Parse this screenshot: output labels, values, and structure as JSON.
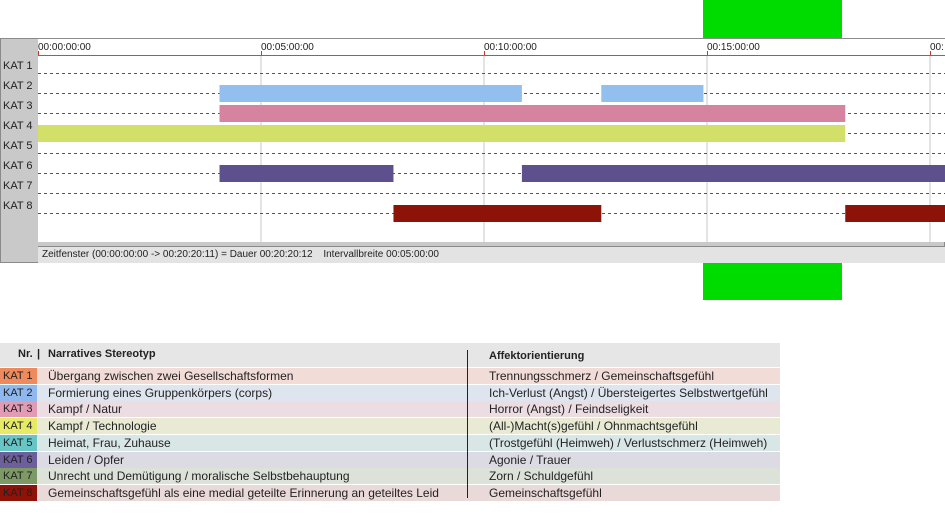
{
  "timeline": {
    "tick_labels": [
      "00:00:00:00",
      "00:05:00:00",
      "00:10:00:00",
      "00:15:00:00",
      "00:"
    ],
    "row_labels": [
      "KAT 1",
      "KAT 2",
      "KAT 3",
      "KAT 4",
      "KAT 5",
      "KAT 6",
      "KAT 7",
      "KAT 8"
    ],
    "status": {
      "window": "Zeitfenster (00:00:00:00 -> 00:20:20:11) = Dauer 00:20:20:12",
      "interval": "Intervallbreite 00:05:00:00"
    },
    "marker_color": "#00dc00"
  },
  "chart_data": {
    "type": "bar",
    "orientation": "timeline",
    "x_unit": "minutes",
    "xlim": [
      0,
      20.35
    ],
    "x_ticks": [
      0,
      5,
      10,
      15,
      20
    ],
    "highlight_range": [
      15,
      18.1
    ],
    "categories": [
      "KAT 1",
      "KAT 2",
      "KAT 3",
      "KAT 4",
      "KAT 5",
      "KAT 6",
      "KAT 7",
      "KAT 8"
    ],
    "series": [
      {
        "category": "KAT 1",
        "color": "#e8845a",
        "segments": []
      },
      {
        "category": "KAT 2",
        "color": "#92bff0",
        "segments": [
          [
            4.07,
            10.85
          ],
          [
            12.63,
            14.92
          ]
        ]
      },
      {
        "category": "KAT 3",
        "color": "#d5839f",
        "segments": [
          [
            4.07,
            18.1
          ]
        ]
      },
      {
        "category": "KAT 4",
        "color": "#d2e06a",
        "segments": [
          [
            0,
            18.1
          ]
        ]
      },
      {
        "category": "KAT 5",
        "color": "#5ec0c2",
        "segments": []
      },
      {
        "category": "KAT 6",
        "color": "#5e508c",
        "segments": [
          [
            4.07,
            7.97
          ],
          [
            10.85,
            20.35
          ]
        ]
      },
      {
        "category": "KAT 7",
        "color": "#6d8c5a",
        "segments": []
      },
      {
        "category": "KAT 8",
        "color": "#8d1208",
        "segments": [
          [
            7.97,
            12.63
          ],
          [
            18.1,
            20.35
          ]
        ]
      }
    ]
  },
  "legend": {
    "header": {
      "nr": "Nr.",
      "stereotype": "Narratives Stereotyp",
      "affekt": "Affektorientierung"
    },
    "rows": [
      {
        "kat": "KAT 1",
        "kat_color": "#ef8a5c",
        "bg": "#f1dcd8",
        "stereotype": "Übergang zwischen zwei Gesellschaftsformen",
        "affekt": "Trennungsschmerz / Gemeinschaftsgefühl"
      },
      {
        "kat": "KAT 2",
        "kat_color": "#8fb8ee",
        "bg": "#dfe5ee",
        "stereotype": "Formierung eines Gruppenkörpers (corps)",
        "affekt": "Ich-Verlust (Angst) / Übersteigertes Selbstwertgefühl"
      },
      {
        "kat": "KAT 3",
        "kat_color": "#e19bb5",
        "bg": "#ecdde3",
        "stereotype": "Kampf / Natur",
        "affekt": "Horror (Angst) / Feindseligkeit"
      },
      {
        "kat": "KAT 4",
        "kat_color": "#e6ea64",
        "bg": "#e8ead4",
        "stereotype": "Kampf / Technologie",
        "affekt": "(All-)Macht(s)gefühl / Ohnmachtsgefühl"
      },
      {
        "kat": "KAT 5",
        "kat_color": "#67c5c5",
        "bg": "#d8e6e6",
        "stereotype": "Heimat, Frau, Zuhause",
        "affekt": "(Trostgefühl (Heimweh) / Verlustschmerz (Heimweh)"
      },
      {
        "kat": "KAT 6",
        "kat_color": "#6d5e9c",
        "bg": "#dcdae3",
        "stereotype": "Leiden / Opfer",
        "affekt": "Agonie / Trauer"
      },
      {
        "kat": "KAT 7",
        "kat_color": "#7d9a66",
        "bg": "#dde2d8",
        "stereotype": "Unrecht und Demütigung / moralische Selbstbehauptung",
        "affekt": "Zorn / Schuldgefühl"
      },
      {
        "kat": "KAT 8",
        "kat_color": "#8d1208",
        "bg": "#ead9d9",
        "stereotype": "Gemeinschaftsgefühl als eine medial geteilte Erinnerung an geteiltes Leid",
        "affekt": "Gemeinschaftsgefühl"
      }
    ]
  }
}
